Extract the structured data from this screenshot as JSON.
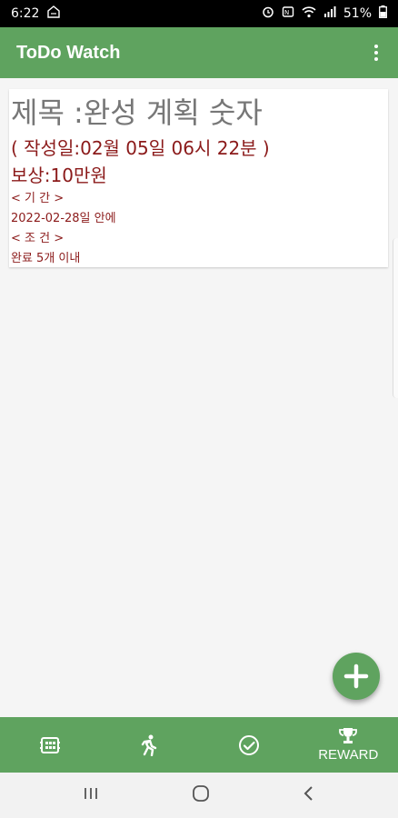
{
  "status_bar": {
    "time": "6:22",
    "battery": "51%"
  },
  "app_bar": {
    "title": "ToDo Watch"
  },
  "card": {
    "title": "제목 :완성 계획 숫자",
    "created": "( 작성일:02월 05일 06시 22분 )",
    "reward": "보상:10만원",
    "period_label": "< 기  간 >",
    "period_value": "2022-02-28일 안에",
    "condition_label": "< 조  건 >",
    "condition_value": "완료 5개 이내"
  },
  "bottom_nav": {
    "items": [
      {
        "icon": "calendar-icon"
      },
      {
        "icon": "running-icon"
      },
      {
        "icon": "check-circle-icon"
      },
      {
        "icon": "trophy-icon",
        "label": "REWARD"
      }
    ]
  },
  "colors": {
    "primary": "#5fa35f",
    "text_dark_red": "#8b1a1a",
    "title_gray": "#777777"
  }
}
